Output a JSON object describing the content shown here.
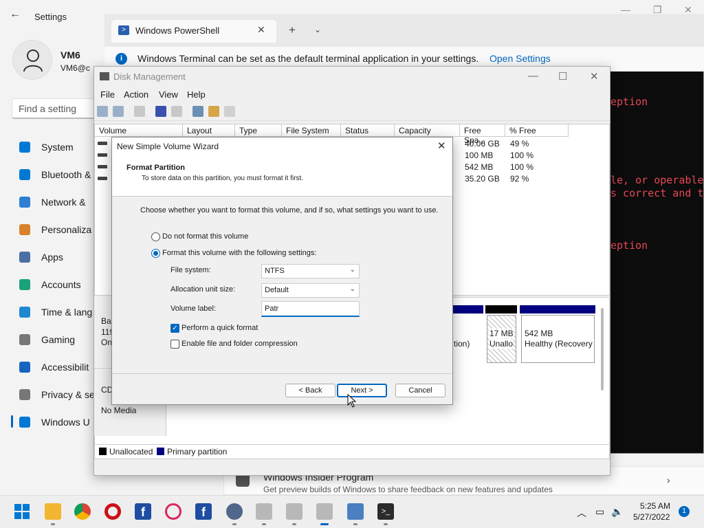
{
  "settings": {
    "title": "Settings",
    "back": "←",
    "user_name": "VM6",
    "user_email": "VM6@c",
    "search_placeholder": "Find a setting",
    "nav": [
      {
        "label": "System",
        "icon": "system-icon",
        "color": "#0078d4"
      },
      {
        "label": "Bluetooth &",
        "icon": "bluetooth-icon",
        "color": "#0078d4"
      },
      {
        "label": "Network &",
        "icon": "network-icon",
        "color": "#2d7fd3"
      },
      {
        "label": "Personaliza",
        "icon": "brush-icon",
        "color": "#d9822b"
      },
      {
        "label": "Apps",
        "icon": "apps-icon",
        "color": "#4a6fa5"
      },
      {
        "label": "Accounts",
        "icon": "accounts-icon",
        "color": "#1aa37a"
      },
      {
        "label": "Time & lang",
        "icon": "clock-icon",
        "color": "#1e88d0"
      },
      {
        "label": "Gaming",
        "icon": "gamepad-icon",
        "color": "#777777"
      },
      {
        "label": "Accessibilit",
        "icon": "accessibility-icon",
        "color": "#1565c0"
      },
      {
        "label": "Privacy & se",
        "icon": "shield-icon",
        "color": "#777777"
      },
      {
        "label": "Windows U",
        "icon": "update-icon",
        "color": "#0078d4"
      }
    ],
    "insider_title": "Windows Insider Program",
    "insider_subtitle": "Get preview builds of Windows to share feedback on new features and updates"
  },
  "powershell": {
    "tab_label": "Windows PowerShell",
    "info_text": "Windows Terminal can be set as the default terminal application in your settings.",
    "info_link": "Open Settings",
    "error_lines": [
      "eption",
      "le, or operable",
      "s correct and t",
      "eption"
    ]
  },
  "disk_management": {
    "title": "Disk Management",
    "menu": [
      "File",
      "Action",
      "View",
      "Help"
    ],
    "columns": [
      "Volume",
      "Layout",
      "Type",
      "File System",
      "Status",
      "Capacity",
      "Free Spa...",
      "% Free"
    ],
    "rows": [
      {
        "free": "40.06 GB",
        "pct": "49 %"
      },
      {
        "free": "100 MB",
        "pct": "100 %"
      },
      {
        "free": "542 MB",
        "pct": "100 %"
      },
      {
        "free": "35.20 GB",
        "pct": "92 %"
      }
    ],
    "disk0_label_partial": [
      "Bas",
      "119",
      "On"
    ],
    "cd_label": "CD",
    "cd_media": "No Media",
    "partial_partition_text": "tion)",
    "unalloc_size": "17 MB",
    "unalloc_label": "Unallo",
    "recovery_size": "542 MB",
    "recovery_status": "Healthy (Recovery",
    "legend": [
      {
        "label": "Unallocated",
        "color": "#000000"
      },
      {
        "label": "Primary partition",
        "color": "#000080"
      }
    ]
  },
  "wizard": {
    "title": "New Simple Volume Wizard",
    "heading": "Format Partition",
    "subheading": "To store data on this partition, you must format it first.",
    "description": "Choose whether you want to format this volume, and if so, what settings you want to use.",
    "option_no_format": "Do not format this volume",
    "option_format": "Format this volume with the following settings:",
    "file_system_label": "File system:",
    "file_system_value": "NTFS",
    "alloc_label": "Allocation unit size:",
    "alloc_value": "Default",
    "volume_label_label": "Volume label:",
    "volume_label_value": "Patr",
    "quick_format": "Perform a quick format",
    "compression": "Enable file and folder compression",
    "back_button": "< Back",
    "next_button": "Next >",
    "cancel_button": "Cancel"
  },
  "taskbar": {
    "time": "5:25 AM",
    "date": "5/27/2022",
    "notifications": "1"
  }
}
